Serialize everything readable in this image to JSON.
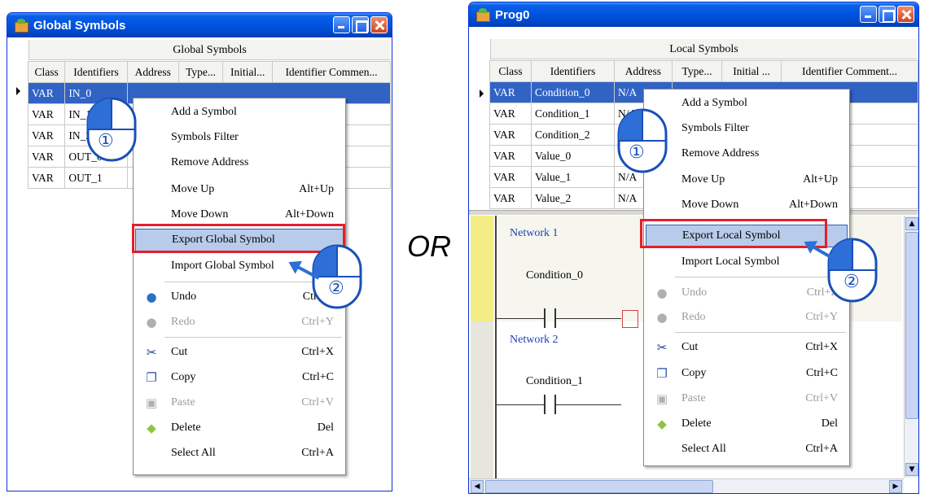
{
  "left_window": {
    "title": "Global Symbols",
    "table_title": "Global Symbols",
    "columns": [
      "Class",
      "Identifiers",
      "Address",
      "Type...",
      "Initial...",
      "Identifier Commen..."
    ],
    "rows": [
      {
        "class": "VAR",
        "identifier": "IN_0"
      },
      {
        "class": "VAR",
        "identifier": "IN_1"
      },
      {
        "class": "VAR",
        "identifier": "IN_2"
      },
      {
        "class": "VAR",
        "identifier": "OUT_0"
      },
      {
        "class": "VAR",
        "identifier": "OUT_1"
      }
    ],
    "menu": {
      "add": "Add a Symbol",
      "filter": "Symbols Filter",
      "remove": "Remove Address",
      "move_up": "Move Up",
      "move_up_sc": "Alt+Up",
      "move_down": "Move Down",
      "move_down_sc": "Alt+Down",
      "export": "Export Global Symbol",
      "import": "Import Global Symbol",
      "undo": "Undo",
      "undo_sc": "Ctrl+Z",
      "redo": "Redo",
      "redo_sc": "Ctrl+Y",
      "cut": "Cut",
      "cut_sc": "Ctrl+X",
      "copy": "Copy",
      "copy_sc": "Ctrl+C",
      "paste": "Paste",
      "paste_sc": "Ctrl+V",
      "delete": "Delete",
      "delete_sc": "Del",
      "select_all": "Select All",
      "select_all_sc": "Ctrl+A"
    }
  },
  "or_label": "OR",
  "right_window": {
    "title": "Prog0",
    "table_title": "Local Symbols",
    "columns": [
      "Class",
      "Identifiers",
      "Address",
      "Type...",
      "Initial ...",
      "Identifier Comment..."
    ],
    "rows": [
      {
        "class": "VAR",
        "identifier": "Condition_0",
        "address": "N/A"
      },
      {
        "class": "VAR",
        "identifier": "Condition_1",
        "address": "N/A"
      },
      {
        "class": "VAR",
        "identifier": "Condition_2",
        "address": ""
      },
      {
        "class": "VAR",
        "identifier": "Value_0",
        "address": ""
      },
      {
        "class": "VAR",
        "identifier": "Value_1",
        "address": "N/A"
      },
      {
        "class": "VAR",
        "identifier": "Value_2",
        "address": "N/A"
      }
    ],
    "networks": [
      {
        "label": "Network 1",
        "contact": "Condition_0"
      },
      {
        "label": "Network 2",
        "contact": "Condition_1"
      }
    ],
    "menu": {
      "add": "Add a Symbol",
      "filter": "Symbols Filter",
      "remove": "Remove Address",
      "move_up": "Move Up",
      "move_up_sc": "Alt+Up",
      "move_down": "Move Down",
      "move_down_sc": "Alt+Down",
      "export": "Export Local Symbol",
      "import": "Import Local Symbol",
      "undo": "Undo",
      "undo_sc": "Ctrl+Z",
      "redo": "Redo",
      "redo_sc": "Ctrl+Y",
      "cut": "Cut",
      "cut_sc": "Ctrl+X",
      "copy": "Copy",
      "copy_sc": "Ctrl+C",
      "paste": "Paste",
      "paste_sc": "Ctrl+V",
      "delete": "Delete",
      "delete_sc": "Del",
      "select_all": "Select All",
      "select_all_sc": "Ctrl+A"
    }
  },
  "steps": {
    "step1": "①",
    "step2": "②"
  },
  "colors": {
    "titlebar": "#0053e0",
    "selection": "#3163c5",
    "highlight": "#b8cbea",
    "callout_box": "#e2202a",
    "mouse": "#2d6fd6"
  }
}
